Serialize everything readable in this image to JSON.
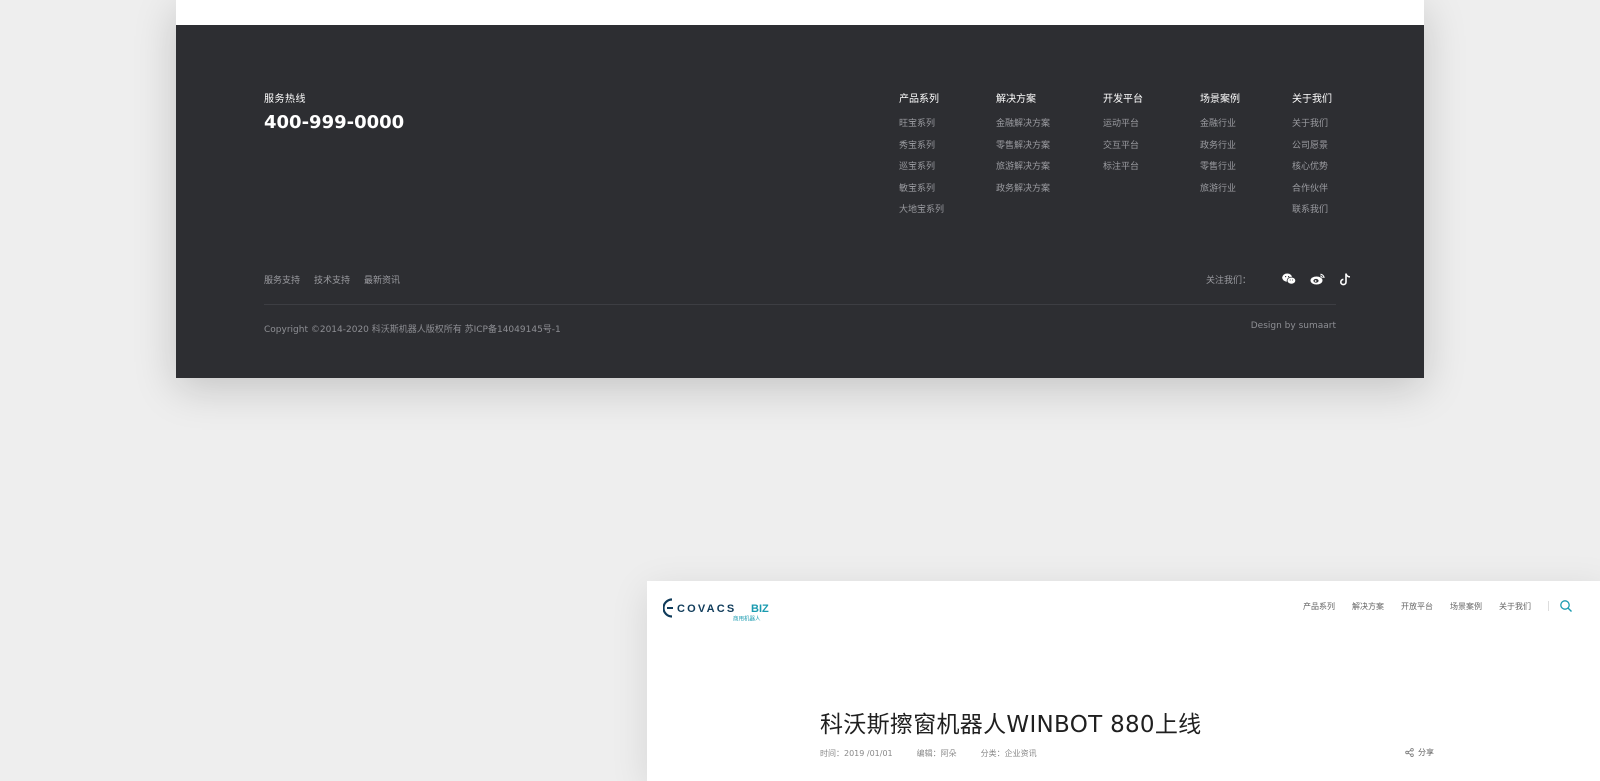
{
  "footer": {
    "hotline_title": "服务热线",
    "hotline_number": "400-999-0000",
    "columns": [
      {
        "title": "产品系列",
        "links": [
          "旺宝系列",
          "秀宝系列",
          "巡宝系列",
          "敏宝系列",
          "大地宝系列"
        ]
      },
      {
        "title": "解决方案",
        "links": [
          "金融解决方案",
          "零售解决方案",
          "旅游解决方案",
          "政务解决方案"
        ]
      },
      {
        "title": "开发平台",
        "links": [
          "运动平台",
          "交互平台",
          "标注平台"
        ]
      },
      {
        "title": "场景案例",
        "links": [
          "金融行业",
          "政务行业",
          "零售行业",
          "旅游行业"
        ]
      },
      {
        "title": "关于我们",
        "links": [
          "关于我们",
          "公司愿景",
          "核心优势",
          "合作伙伴",
          "联系我们"
        ]
      }
    ],
    "bottom_links": [
      "服务支持",
      "技术支持",
      "最新资讯"
    ],
    "follow_label": "关注我们：",
    "social_icons": [
      "wechat-icon",
      "weibo-icon",
      "douyin-icon"
    ],
    "copyright": "Copyright ©2014-2020 科沃斯机器人版权所有   苏ICP备14049145号-1",
    "design_by": "Design by sumaart"
  },
  "article_page": {
    "logo_text": "ECOVACS BIZ",
    "logo_subtext": "商用机器人",
    "nav": [
      "产品系列",
      "解决方案",
      "开放平台",
      "场景案例",
      "关于我们"
    ],
    "title": "科沃斯擦窗机器人WINBOT 880上线",
    "meta": {
      "time": "时间：2019 /01/01",
      "editor": "编辑：阿朵",
      "category": "分类：企业资讯"
    },
    "share_label": "分享"
  },
  "colors": {
    "footer_bg": "#2d2e32",
    "page_bg": "#eeeeee",
    "brand_teal": "#1a9bb0",
    "brand_dark": "#0f3b5a"
  }
}
